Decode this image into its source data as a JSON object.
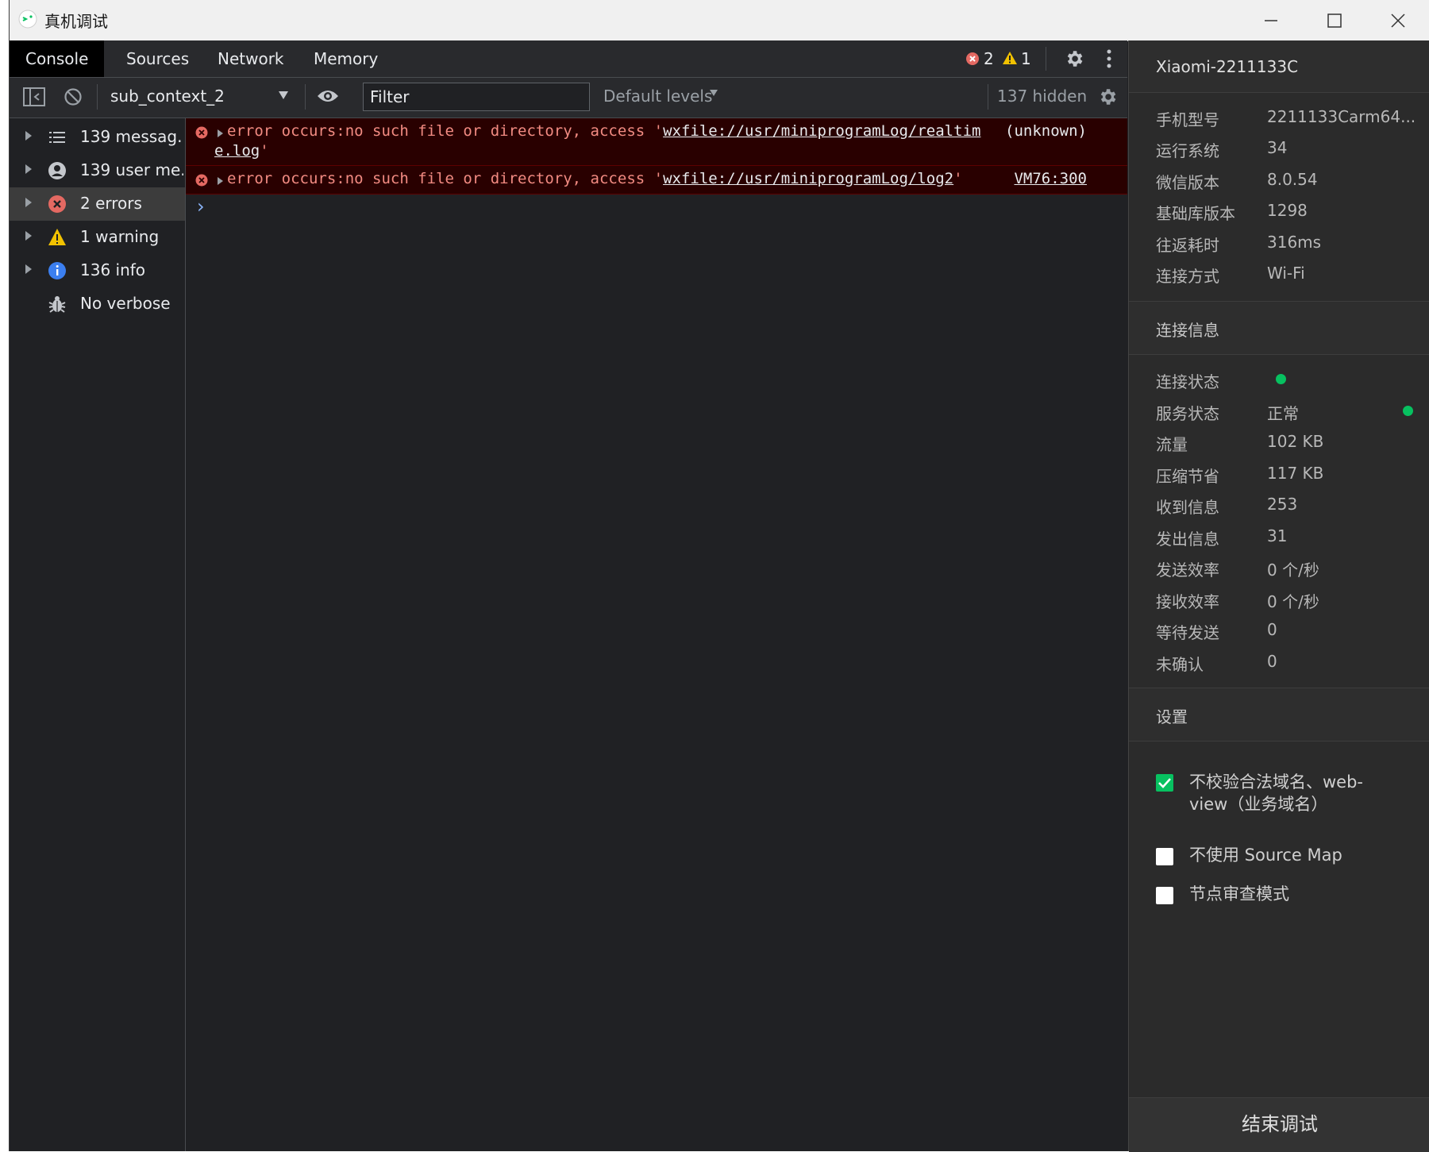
{
  "window": {
    "title": "真机调试"
  },
  "devtools": {
    "tabs": [
      {
        "label": "Console"
      },
      {
        "label": "Sources"
      },
      {
        "label": "Network"
      },
      {
        "label": "Memory"
      }
    ],
    "error_count": "2",
    "warning_count": "1",
    "toolbar": {
      "context": "sub_context_2",
      "filter_placeholder": "Filter",
      "levels": "Default levels",
      "hidden": "137 hidden"
    },
    "sidebar": [
      {
        "label": "139 messag..."
      },
      {
        "label": "139 user me..."
      },
      {
        "label": "2 errors"
      },
      {
        "label": "1 warning"
      },
      {
        "label": "136 info"
      },
      {
        "label": "No verbose"
      }
    ],
    "messages": [
      {
        "text_prefix": "error occurs:no such file or directory, access '",
        "link_line1": "wxfile://usr/miniprogramLog/realtim",
        "link_line2": "e.log",
        "text_suffix": "'",
        "source": "(unknown)"
      },
      {
        "text_prefix": "error occurs:no such file or directory, access '",
        "link": "wxfile://usr/miniprogramLog/log2",
        "text_suffix": "'",
        "source": "VM76:300"
      }
    ],
    "prompt": "›"
  },
  "device": {
    "name": "Xiaomi-2211133C",
    "info": [
      {
        "key": "手机型号",
        "value": "2211133Carm64..."
      },
      {
        "key": "运行系统",
        "value": "34"
      },
      {
        "key": "微信版本",
        "value": "8.0.54"
      },
      {
        "key": "基础库版本",
        "value": "1298"
      },
      {
        "key": "往返耗时",
        "value": "316ms"
      },
      {
        "key": "连接方式",
        "value": "Wi-Fi"
      }
    ],
    "connection_title": "连接信息",
    "connection": [
      {
        "key": "连接状态",
        "value": ""
      },
      {
        "key": "服务状态",
        "value": "正常"
      },
      {
        "key": "流量",
        "value": "102 KB"
      },
      {
        "key": "压缩节省",
        "value": "117 KB"
      },
      {
        "key": "收到信息",
        "value": "253"
      },
      {
        "key": "发出信息",
        "value": "31"
      },
      {
        "key": "发送效率",
        "value": "0 个/秒"
      },
      {
        "key": "接收效率",
        "value": "0 个/秒"
      },
      {
        "key": "等待发送",
        "value": "0"
      },
      {
        "key": "未确认",
        "value": "0"
      }
    ],
    "settings_title": "设置",
    "settings": [
      {
        "line1": "不校验合法域名、web-",
        "line2": "view（业务域名）",
        "checked": true
      },
      {
        "line1": "不使用 Source Map",
        "checked": false
      },
      {
        "line1": "节点审查模式",
        "checked": false
      }
    ],
    "end_button": "结束调试",
    "status_color": "#07c160"
  }
}
